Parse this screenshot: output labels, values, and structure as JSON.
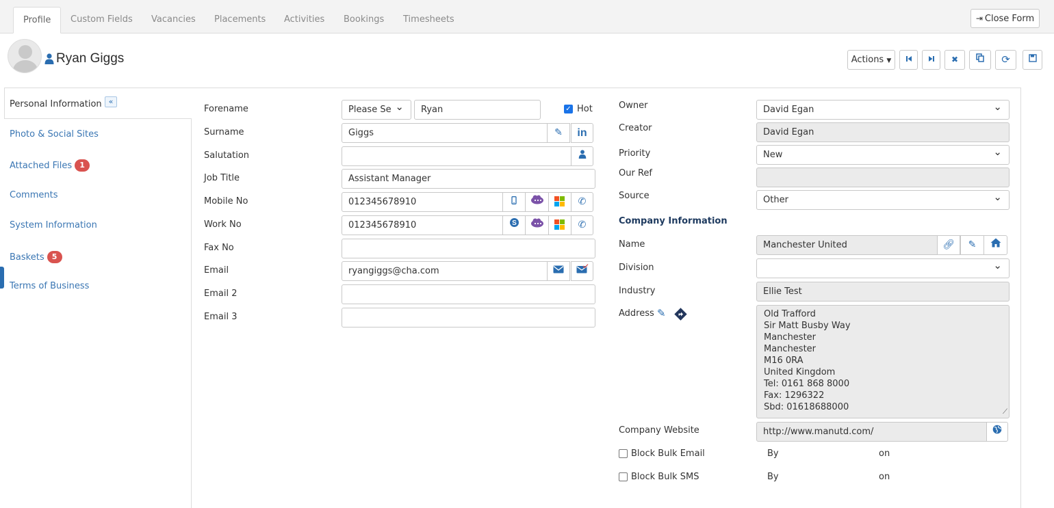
{
  "tabs": [
    "Profile",
    "Custom Fields",
    "Vacancies",
    "Placements",
    "Activities",
    "Bookings",
    "Timesheets"
  ],
  "close_form_label": "Close Form",
  "header": {
    "name": "Ryan Giggs",
    "actions_label": "Actions"
  },
  "sidenav": {
    "items": [
      {
        "label": "Personal Information"
      },
      {
        "label": "Photo & Social Sites"
      },
      {
        "label": "Attached Files",
        "badge": "1"
      },
      {
        "label": "Comments"
      },
      {
        "label": "System Information"
      },
      {
        "label": "Baskets",
        "badge": "5"
      },
      {
        "label": "Terms of Business"
      }
    ]
  },
  "form": {
    "forename_label": "Forename",
    "title_select": "Please Se",
    "forename": "Ryan",
    "hot_label": "Hot",
    "surname_label": "Surname",
    "surname": "Giggs",
    "salutation_label": "Salutation",
    "salutation": "",
    "job_title_label": "Job Title",
    "job_title": "Assistant Manager",
    "mobile_label": "Mobile No",
    "mobile": "012345678910",
    "work_label": "Work No",
    "work": "012345678910",
    "fax_label": "Fax No",
    "fax": "",
    "email_label": "Email",
    "email": "ryangiggs@cha.com",
    "email2_label": "Email 2",
    "email2": "",
    "email3_label": "Email 3",
    "email3": ""
  },
  "right": {
    "owner_label": "Owner",
    "owner": "David Egan",
    "creator_label": "Creator",
    "creator": "David Egan",
    "priority_label": "Priority",
    "priority": "New",
    "our_ref_label": "Our Ref",
    "our_ref": "",
    "source_label": "Source",
    "source": "Other",
    "company_section": "Company Information",
    "name_label": "Name",
    "company_name": "Manchester United",
    "division_label": "Division",
    "division": "",
    "industry_label": "Industry",
    "industry": "Ellie Test",
    "address_label": "Address",
    "address_lines": [
      "Old Trafford",
      "Sir Matt Busby Way",
      "Manchester",
      "Manchester",
      "M16 0RA",
      "United Kingdom",
      "Tel: 0161 868 8000",
      "Fax: 1296322",
      "Sbd: 01618688000"
    ],
    "website_label": "Company Website",
    "website": "http://www.manutd.com/",
    "block_email_label": "Block Bulk Email",
    "block_sms_label": "Block Bulk SMS",
    "by_label": "By",
    "on_label": "on"
  },
  "colors": {
    "accent": "#2a6db0",
    "badge": "#d9534f",
    "section_title": "#1e3a5f"
  }
}
